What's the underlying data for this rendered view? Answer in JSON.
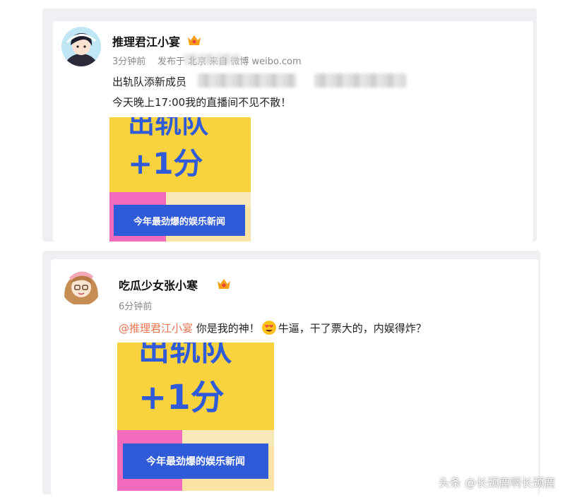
{
  "post1": {
    "author": "推理君江小宴",
    "time": "3分钟前",
    "source": "发布于 北京 来自 微博 weibo.com",
    "line1": "出轨队添新成员",
    "line2": "今天晚上17:00我的直播间不见不散！",
    "poster": {
      "headline": "出轨队",
      "score": "+1分",
      "banner": "今年最劲爆的娱乐新闻"
    }
  },
  "post2": {
    "author": "吃瓜少女张小寒",
    "time": "6分钟前",
    "mention": "@推理君江小宴",
    "text_a": " 你是我的神！",
    "text_b": "牛逼，干了票大的，内娱得炸？",
    "poster": {
      "headline": "出轨队",
      "score": "+1分",
      "banner": "今年最劲爆的娱乐新闻"
    }
  },
  "watermark": "头条 @长颈鹿啊长颈鹿",
  "colors": {
    "panel": "#eef0f3",
    "mention": "#eb7350",
    "poster_blue": "#2f5ad8",
    "poster_yellow": "#f9d33f",
    "poster_pink": "#f36bbd"
  },
  "icons": [
    "avatar-boy-icon",
    "avatar-girl-icon",
    "vip-badge-icon",
    "heart-eyes-emoji-icon"
  ]
}
